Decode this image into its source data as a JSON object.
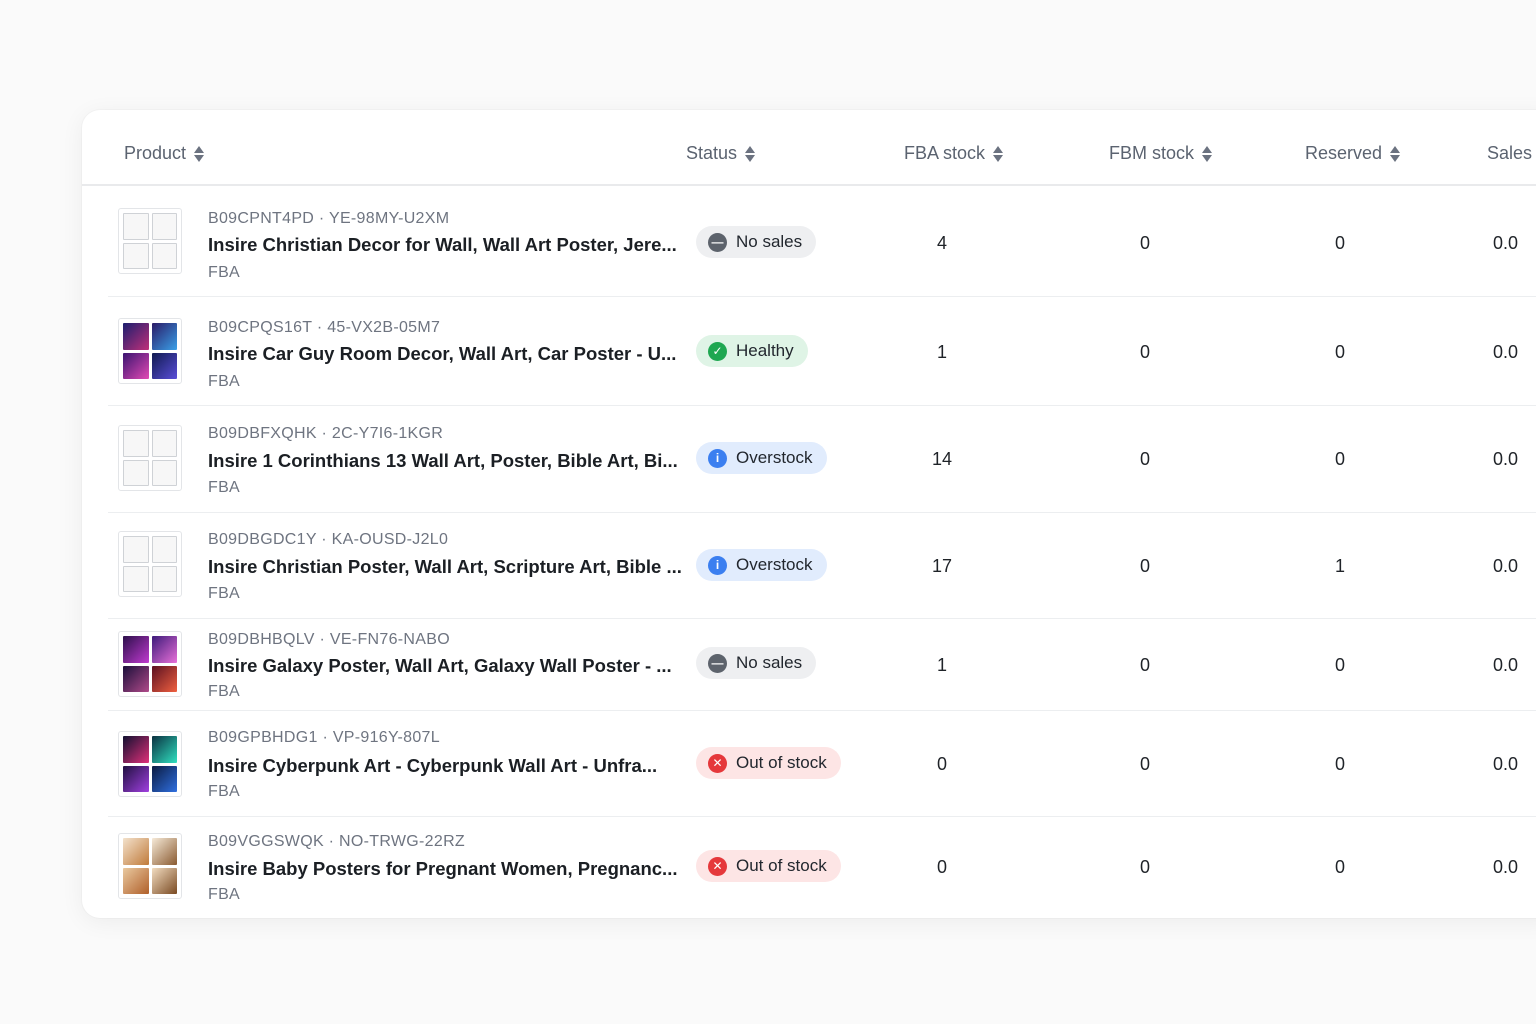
{
  "columns": {
    "product": "Product",
    "status": "Status",
    "fba_stock": "FBA stock",
    "fbm_stock": "FBM stock",
    "reserved": "Reserved",
    "sales": "Sales"
  },
  "status_colors": {
    "no_sales": "#5d636c",
    "healthy": "#1fa751",
    "overstock": "#3b7ff0",
    "out_of_stock": "#e5383b"
  },
  "rows": [
    {
      "ids": "B09CPNT4PD · YE-98MY-U2XM",
      "title": "Insire Christian Decor for Wall, Wall Art Poster, Jere...",
      "channel": "FBA",
      "status": "No sales",
      "status_icon": "minus-circle-icon",
      "fba": "4",
      "fbm": "0",
      "reserved": "0",
      "sales": "0.0"
    },
    {
      "ids": "B09CPQS16T · 45-VX2B-05M7",
      "title": "Insire Car Guy Room Decor, Wall Art, Car Poster - U...",
      "channel": "FBA",
      "status": "Healthy",
      "status_icon": "check-circle-icon",
      "fba": "1",
      "fbm": "0",
      "reserved": "0",
      "sales": "0.0"
    },
    {
      "ids": "B09DBFXQHK · 2C-Y7I6-1KGR",
      "title": "Insire 1 Corinthians 13 Wall Art, Poster, Bible Art, Bi...",
      "channel": "FBA",
      "status": "Overstock",
      "status_icon": "info-circle-icon",
      "fba": "14",
      "fbm": "0",
      "reserved": "0",
      "sales": "0.0"
    },
    {
      "ids": "B09DBGDC1Y · KA-OUSD-J2L0",
      "title": "Insire Christian Poster, Wall Art, Scripture Art, Bible ...",
      "channel": "FBA",
      "status": "Overstock",
      "status_icon": "info-circle-icon",
      "fba": "17",
      "fbm": "0",
      "reserved": "1",
      "sales": "0.0"
    },
    {
      "ids": "B09DBHBQLV · VE-FN76-NABO",
      "title": "Insire Galaxy Poster, Wall Art, Galaxy Wall Poster - ...",
      "channel": "FBA",
      "status": "No sales",
      "status_icon": "minus-circle-icon",
      "fba": "1",
      "fbm": "0",
      "reserved": "0",
      "sales": "0.0"
    },
    {
      "ids": "B09GPBHDG1 · VP-916Y-807L",
      "title": "Insire Cyberpunk Art - Cyberpunk Wall Art - Unfra...",
      "channel": "FBA",
      "status": "Out of stock",
      "status_icon": "x-circle-icon",
      "fba": "0",
      "fbm": "0",
      "reserved": "0",
      "sales": "0.0"
    },
    {
      "ids": "B09VGGSWQK · NO-TRWG-22RZ",
      "title": "Insire Baby Posters for Pregnant Women, Pregnanc...",
      "channel": "FBA",
      "status": "Out of stock",
      "status_icon": "x-circle-icon",
      "fba": "0",
      "fbm": "0",
      "reserved": "0",
      "sales": "0.0"
    }
  ]
}
